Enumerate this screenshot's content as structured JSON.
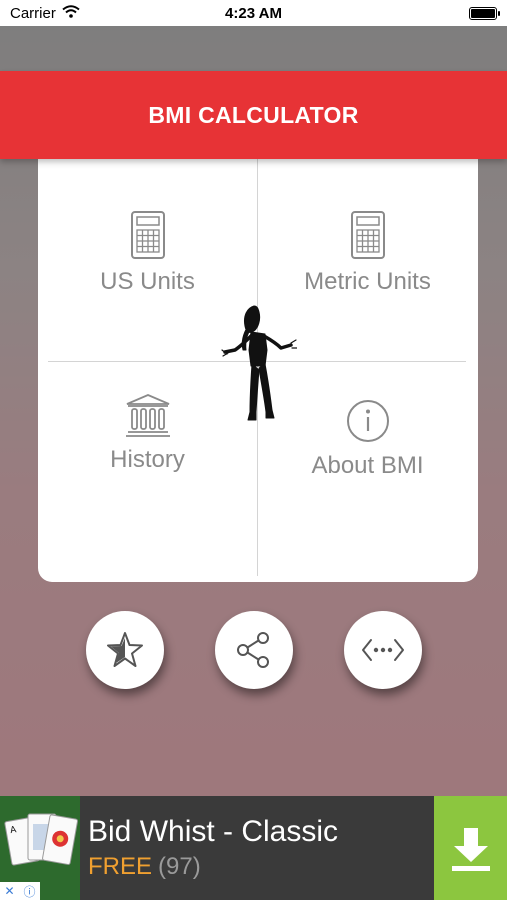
{
  "status_bar": {
    "carrier": "Carrier",
    "time": "4:23 AM"
  },
  "header": {
    "title": "BMI CALCULATOR"
  },
  "menu": {
    "us_units": "US Units",
    "metric_units": "Metric Units",
    "history": "History",
    "about": "About BMI"
  },
  "icons": {
    "us_units": "calculator-icon",
    "metric_units": "calculator-icon",
    "history": "bank-building-icon",
    "about": "info-icon",
    "favorite": "star-icon",
    "share": "share-icon",
    "more": "code-more-icon",
    "download": "download-icon"
  },
  "ad": {
    "title": "Bid Whist - Classic",
    "price": "FREE",
    "rating_count": "(97)"
  },
  "colors": {
    "header": "#e73336",
    "ad_download": "#8cc63f",
    "ad_price": "#f0a030"
  }
}
